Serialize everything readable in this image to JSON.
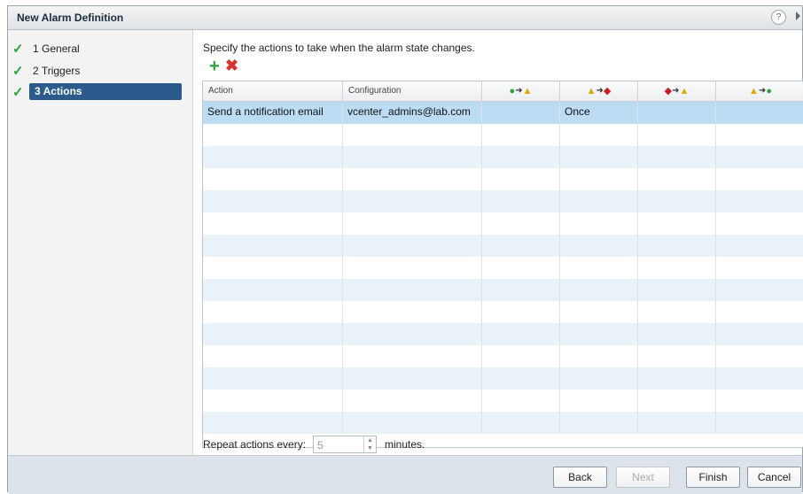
{
  "dialog": {
    "title": "New Alarm Definition",
    "help_symbol": "?"
  },
  "steps": [
    {
      "number": "1",
      "label": "General",
      "done": true,
      "active": false
    },
    {
      "number": "2",
      "label": "Triggers",
      "done": true,
      "active": false
    },
    {
      "number": "3",
      "label": "Actions",
      "done": true,
      "active": true
    }
  ],
  "main": {
    "instruction": "Specify the actions to take when the alarm state changes.",
    "toolbar": {
      "add_icon": "add-icon",
      "remove_icon": "remove-icon"
    }
  },
  "grid": {
    "columns": [
      {
        "label": "Action",
        "type": "text"
      },
      {
        "label": "Configuration",
        "type": "text"
      },
      {
        "type": "transition",
        "from": "ok",
        "to": "warn"
      },
      {
        "type": "transition",
        "from": "warn",
        "to": "crit"
      },
      {
        "type": "transition",
        "from": "crit",
        "to": "warn"
      },
      {
        "type": "transition",
        "from": "warn",
        "to": "ok"
      }
    ],
    "rows": [
      [
        "Send a notification email",
        "vcenter_admins@lab.com",
        "",
        "Once",
        "",
        ""
      ]
    ],
    "empty_rows": 14
  },
  "repeat": {
    "label": "Repeat actions every:",
    "value": "5",
    "unit": "minutes."
  },
  "footer": {
    "back": "Back",
    "next": "Next",
    "finish": "Finish",
    "cancel": "Cancel"
  },
  "colors": {
    "selected_row": "#bcdcf4",
    "active_step": "#2a5b8c",
    "check": "#2ba33b"
  }
}
